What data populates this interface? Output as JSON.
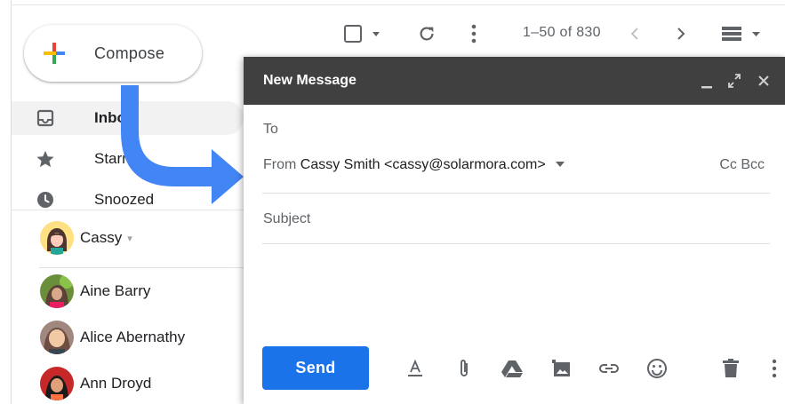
{
  "compose": {
    "label": "Compose",
    "icon": "plus-multicolor-icon"
  },
  "sidebar": {
    "items": [
      {
        "label": "Inbox",
        "icon": "inbox-icon",
        "active": true
      },
      {
        "label": "Starred",
        "icon": "star-icon"
      },
      {
        "label": "Snoozed",
        "icon": "clock-icon"
      }
    ]
  },
  "hangouts": {
    "user": {
      "name": "Cassy",
      "caret": "▾"
    },
    "contacts": [
      {
        "name": "Aine Barry"
      },
      {
        "name": "Alice Abernathy"
      },
      {
        "name": "Ann Droyd"
      }
    ]
  },
  "toolbar": {
    "pager": "1–50 of 830"
  },
  "message": {
    "title": "New Message",
    "to_label": "To",
    "from_label": "From",
    "from_value": "Cassy Smith <cassy@solarmora.com>",
    "cc_bcc": "Cc Bcc",
    "subject_placeholder": "Subject",
    "send_label": "Send"
  },
  "colors": {
    "accent": "#1a73e8",
    "arrow": "#4285f4",
    "header": "#404040"
  }
}
